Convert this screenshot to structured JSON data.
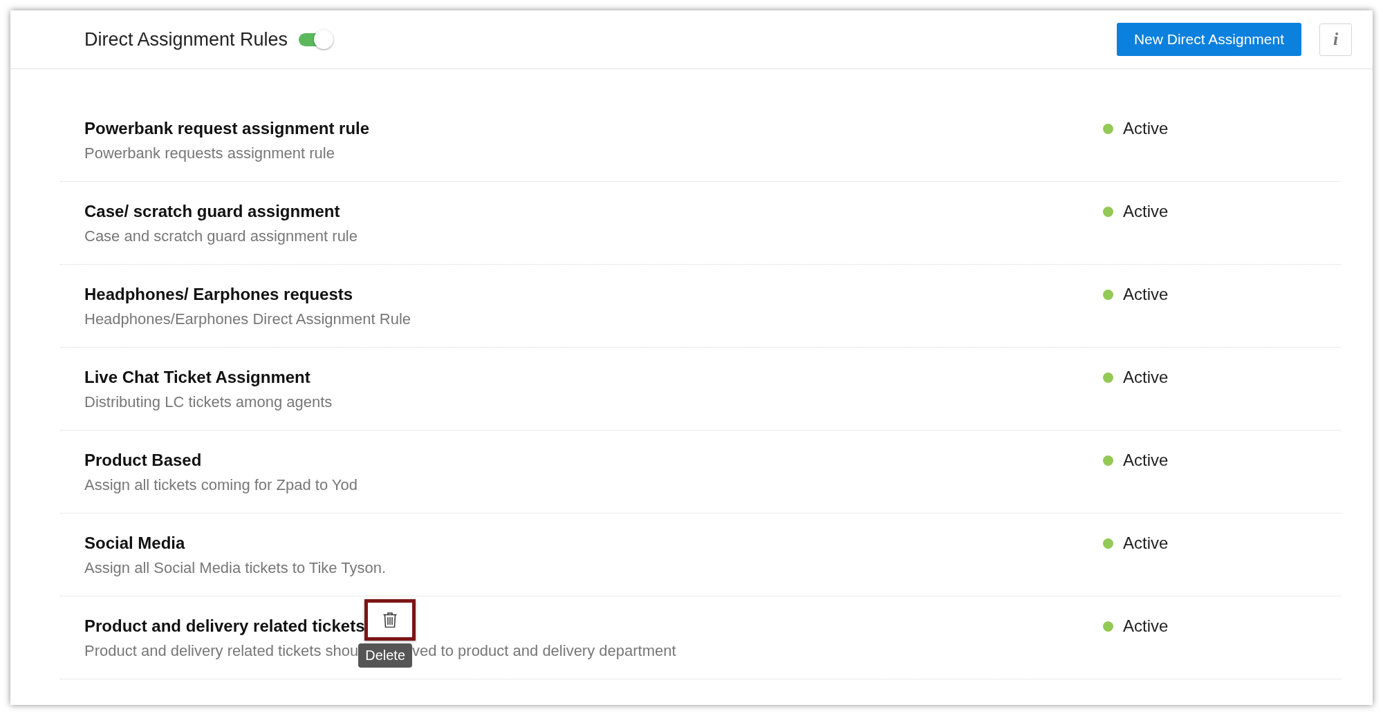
{
  "header": {
    "title": "Direct Assignment Rules",
    "enabled": true,
    "new_button": "New Direct Assignment",
    "info_button": "i"
  },
  "rules": [
    {
      "name": "Powerbank request assignment rule",
      "description": [
        "Powerbank requests assignment rule"
      ],
      "status": "Active",
      "color": "#93c955",
      "hovered": false
    },
    {
      "name": "Case/ scratch guard assignment",
      "description": [
        "Case and scratch guard assignment rule"
      ],
      "status": "Active",
      "color": "#93c955",
      "hovered": false
    },
    {
      "name": "Headphones/ Earphones requests",
      "description": [
        "Headphones/Earphones Direct Assignment Rule"
      ],
      "status": "Active",
      "color": "#93c955",
      "hovered": false
    },
    {
      "name": "Live Chat Ticket Assignment",
      "description": [
        "Distributing LC tickets among agents"
      ],
      "status": "Active",
      "color": "#93c955",
      "hovered": false
    },
    {
      "name": "Product Based",
      "description": [
        "Assign all tickets coming for Zpad to Yod"
      ],
      "status": "Active",
      "color": "#93c955",
      "hovered": false
    },
    {
      "name": "Social Media",
      "description": [
        "Assign all Social Media tickets to Tike Tyson."
      ],
      "status": "Active",
      "color": "#93c955",
      "hovered": false
    },
    {
      "name": "Product and delivery related tickets",
      "description": [
        "Product and delivery related tickets shou",
        "ved to product and delivery department"
      ],
      "status": "Active",
      "color": "#93c955",
      "hovered": true,
      "tooltip": "Delete"
    }
  ]
}
